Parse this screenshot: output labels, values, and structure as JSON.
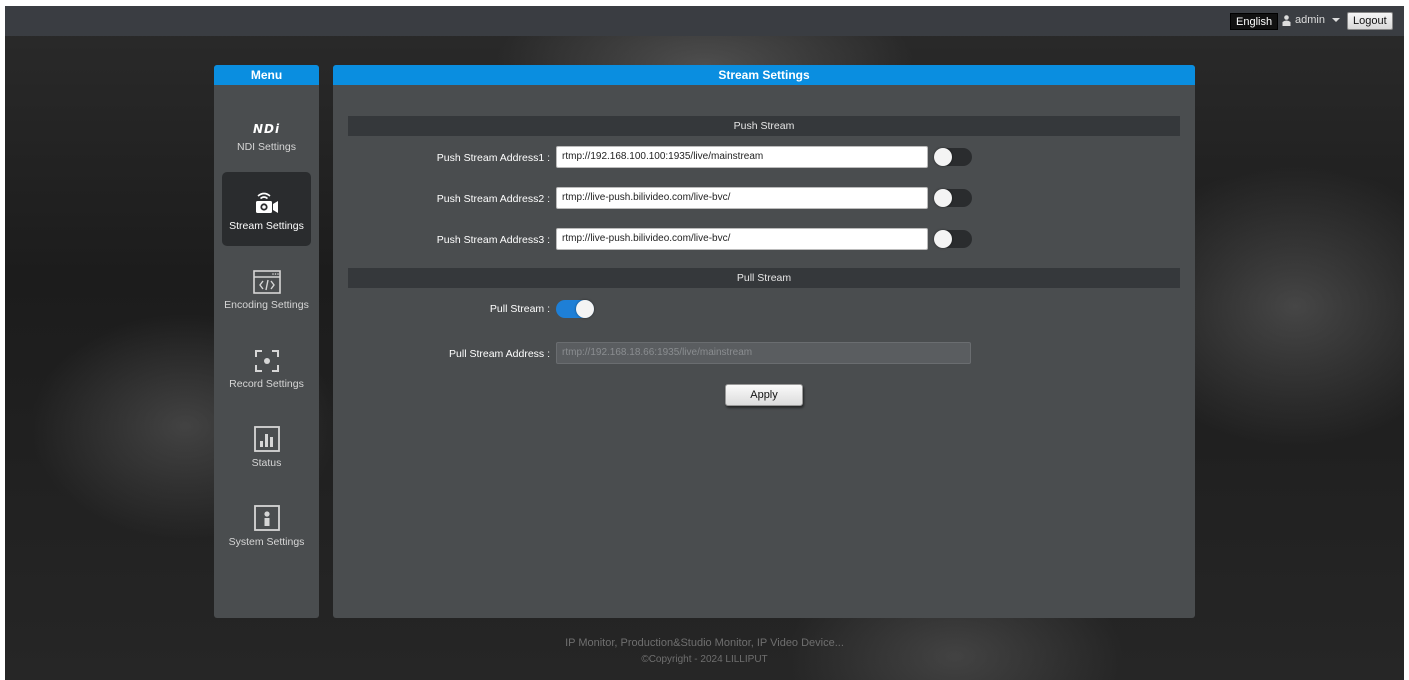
{
  "topbar": {
    "language": "English",
    "user": "admin",
    "logout_label": "Logout"
  },
  "sidebar": {
    "title": "Menu",
    "items": [
      {
        "label": "NDI Settings",
        "icon": "ndi-logo",
        "logo_text": "NDi",
        "active": false
      },
      {
        "label": "Stream Settings",
        "icon": "stream-camera-icon",
        "active": true
      },
      {
        "label": "Encoding Settings",
        "icon": "code-window-icon",
        "active": false
      },
      {
        "label": "Record Settings",
        "icon": "record-focus-icon",
        "active": false
      },
      {
        "label": "Status",
        "icon": "bar-chart-icon",
        "active": false
      },
      {
        "label": "System Settings",
        "icon": "system-person-icon",
        "active": false
      }
    ]
  },
  "main": {
    "title": "Stream Settings",
    "push_section": "Push Stream",
    "push_rows": [
      {
        "label": "Push Stream Address1 :",
        "value": "rtmp://192.168.100.100:1935/live/mainstream",
        "enabled": false
      },
      {
        "label": "Push Stream Address2 :",
        "value": "rtmp://live-push.bilivideo.com/live-bvc/",
        "enabled": false
      },
      {
        "label": "Push Stream Address3 :",
        "value": "rtmp://live-push.bilivideo.com/live-bvc/",
        "enabled": false
      }
    ],
    "pull_section": "Pull Stream",
    "pull_stream_label": "Pull Stream :",
    "pull_stream_enabled": true,
    "pull_address_label": "Pull Stream Address :",
    "pull_address_placeholder": "rtmp://192.168.18.66:1935/live/mainstream",
    "apply_label": "Apply"
  },
  "footer": {
    "line1": "IP Monitor, Production&Studio Monitor, IP Video Device...",
    "line2": "©Copyright - 2024 LILLIPUT"
  },
  "colors": {
    "accent": "#0a8ee0",
    "panel": "#4a4d4f",
    "toggle_on": "#1e7fd6"
  }
}
